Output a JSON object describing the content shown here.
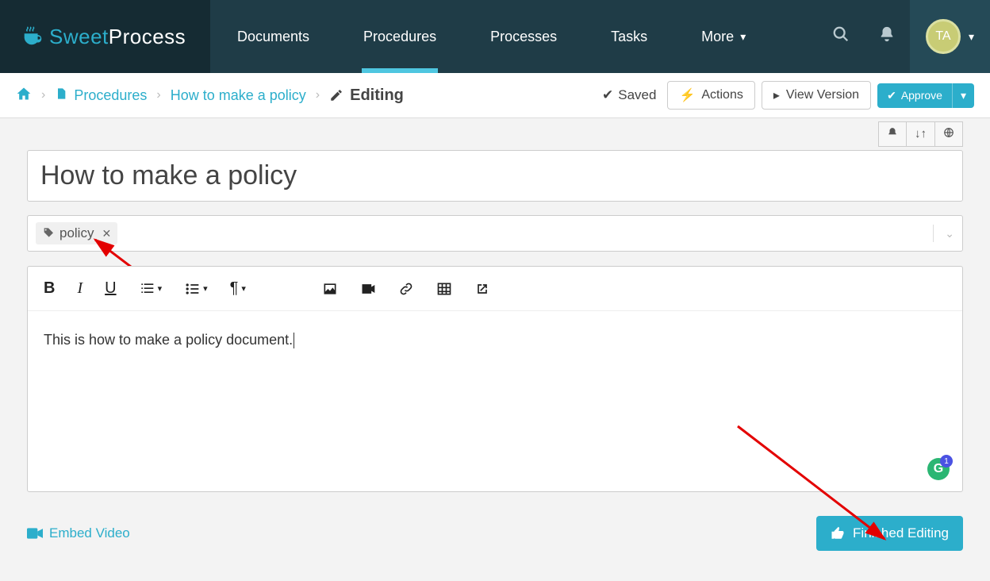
{
  "brand": {
    "sweet": "Sweet",
    "process": "Process"
  },
  "nav": {
    "documents": "Documents",
    "procedures": "Procedures",
    "processes": "Processes",
    "tasks": "Tasks",
    "more": "More"
  },
  "user": {
    "initials": "TA"
  },
  "breadcrumb": {
    "root": "Procedures",
    "item": "How to make a policy",
    "state": "Editing"
  },
  "subbar": {
    "saved": "Saved",
    "actions": "Actions",
    "view_version": "View Version",
    "approve": "Approve"
  },
  "title": "How to make a policy",
  "tags": [
    {
      "label": "policy"
    }
  ],
  "editor": {
    "content": "This is how to make a policy document."
  },
  "grammarly_badge": "1",
  "bottom": {
    "embed_video": "Embed Video",
    "finished": "Finished Editing"
  }
}
